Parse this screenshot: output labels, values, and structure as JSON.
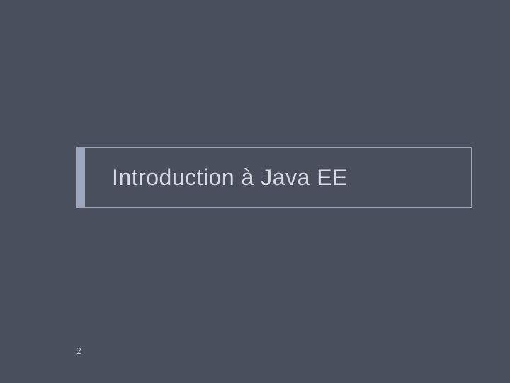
{
  "slide": {
    "title": "Introduction à Java EE",
    "page_number": "2"
  },
  "colors": {
    "background": "#4a4f5d",
    "accent": "#9ca6bd",
    "title_text": "#d6dae3",
    "page_text": "#c8ccd6"
  }
}
